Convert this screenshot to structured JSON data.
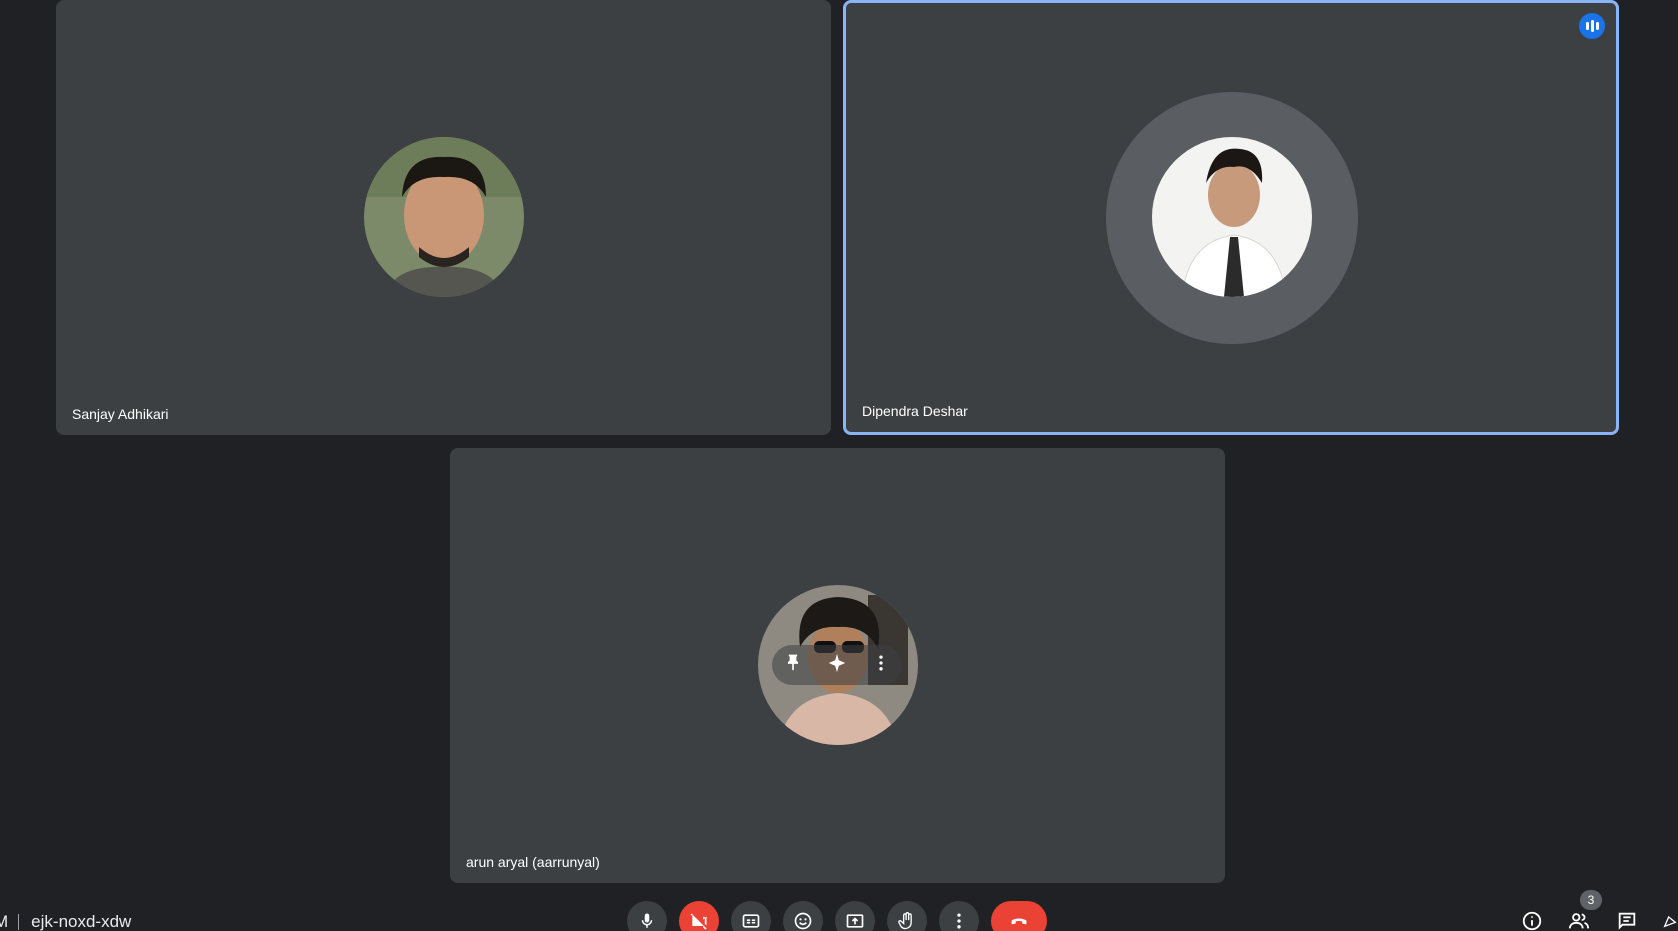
{
  "tiles": [
    {
      "name": "Sanjay Adhikari",
      "speaking": false
    },
    {
      "name": "Dipendra Deshar",
      "speaking": true
    },
    {
      "name": "arun aryal (aarrunyal)",
      "speaking": false
    }
  ],
  "meeting": {
    "code": "ejk-noxd-xdw",
    "time_fragment": "M"
  },
  "people_count": "3",
  "icons": {
    "mic": "mic-icon",
    "camera_off": "camera-off-icon",
    "captions": "captions-icon",
    "reactions": "emoji-icon",
    "present": "present-screen-icon",
    "raise_hand": "hand-icon",
    "more": "more-vert-icon",
    "leave": "call-end-icon",
    "info": "info-icon",
    "people": "people-icon",
    "chat": "chat-icon",
    "activities": "activities-icon",
    "pin": "pin-icon",
    "effects": "sparkle-icon",
    "speaking": "speaking-indicator-icon"
  },
  "colors": {
    "background": "#202124",
    "tile": "#3c4043",
    "active_speaker": "#8ab4f8",
    "danger": "#ea4335",
    "accent": "#1a73e8"
  }
}
